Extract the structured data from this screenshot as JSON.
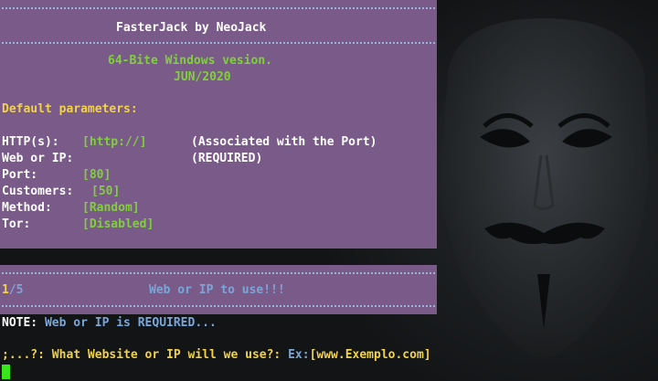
{
  "banner": {
    "title": "FasterJack by NeoJack",
    "version": "64-Bite Windows vesion.",
    "date": "JUN/2020",
    "defaults_heading": "Default parameters:"
  },
  "params": {
    "http_label": "HTTP(s):",
    "http_value": "[http://]",
    "http_note": "(Associated with the Port)",
    "web_label": "Web or IP:",
    "web_note": "(REQUIRED)",
    "port_label": "Port:",
    "port_value": "[80]",
    "customers_label": "Customers:",
    "customers_value": "[50]",
    "method_label": "Method:",
    "method_value": "[Random]",
    "tor_label": "Tor:",
    "tor_value": "[Disabled]"
  },
  "step": {
    "current": "1",
    "total": "/5",
    "message": "Web or IP to use!!!"
  },
  "note": {
    "label": "NOTE:",
    "text": "Web or IP is REQUIRED..."
  },
  "prompt": {
    "prefix": ";...?:",
    "question": "What Website or IP will we use?:",
    "example_label": "Ex:",
    "example_value": "[www.Exemplo.com]"
  },
  "colors": {
    "panel": "#7a5a88",
    "green": "#7fd13b",
    "yellow": "#f2d24b",
    "blue": "#7aa6d8",
    "cursor": "#39e61b",
    "background": "#0f1112"
  },
  "icons": {
    "background_art": "guy-fawkes-mask-icon"
  }
}
